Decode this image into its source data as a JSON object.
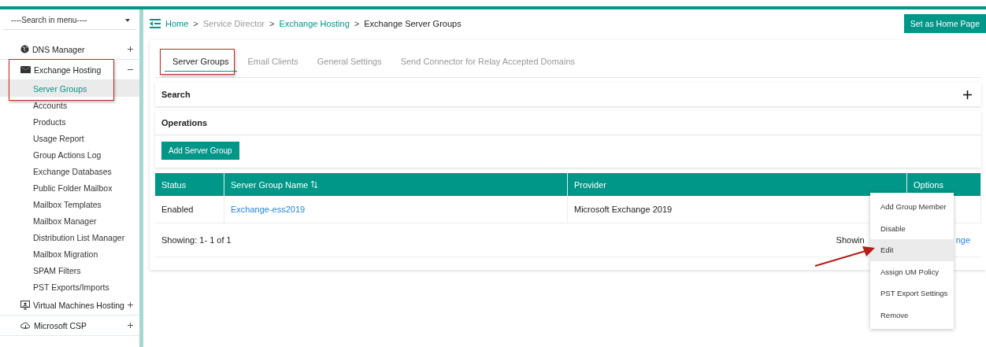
{
  "sidebar": {
    "search": {
      "placeholder": "----Search in menu----"
    },
    "items": [
      {
        "label": "DNS Manager",
        "expanded": false
      },
      {
        "label": "Exchange Hosting",
        "expanded": true,
        "children": [
          {
            "label": "Server Groups",
            "selected": true
          },
          {
            "label": "Accounts",
            "selected": false
          },
          {
            "label": "Products",
            "selected": false
          },
          {
            "label": "Usage Report",
            "selected": false
          },
          {
            "label": "Group Actions Log",
            "selected": false
          },
          {
            "label": "Exchange Databases",
            "selected": false
          },
          {
            "label": "Public Folder Mailbox",
            "selected": false
          },
          {
            "label": "Mailbox Templates",
            "selected": false
          },
          {
            "label": "Mailbox Manager",
            "selected": false
          },
          {
            "label": "Distribution List Manager",
            "selected": false
          },
          {
            "label": "Mailbox Migration",
            "selected": false
          },
          {
            "label": "SPAM Filters",
            "selected": false
          },
          {
            "label": "PST Exports/Imports",
            "selected": false
          }
        ]
      },
      {
        "label": "Virtual Machines Hosting",
        "expanded": false
      },
      {
        "label": "Microsoft CSP",
        "expanded": false
      }
    ]
  },
  "breadcrumb_separator": ">",
  "breadcrumb": [
    {
      "label": "Home",
      "kind": "link"
    },
    {
      "label": "Service Director",
      "kind": "muted"
    },
    {
      "label": "Exchange Hosting",
      "kind": "link"
    },
    {
      "label": "Exchange Server Groups",
      "kind": "current"
    }
  ],
  "home_button": "Set as Home Page",
  "tabs": [
    {
      "label": "Server Groups",
      "selected": true
    },
    {
      "label": "Email Clients",
      "selected": false
    },
    {
      "label": "General Settings",
      "selected": false
    },
    {
      "label": "Send Connector for Relay Accepted Domains",
      "selected": false
    }
  ],
  "search_panel": {
    "title": "Search",
    "expanded": false
  },
  "operations": {
    "title": "Operations",
    "buttons": [
      "Add Server Group"
    ]
  },
  "table": {
    "columns": [
      {
        "label": "Status",
        "sortable": false
      },
      {
        "label": "Server Group Name",
        "sortable": true
      },
      {
        "label": "Provider",
        "sortable": false
      },
      {
        "label": "Options",
        "sortable": false
      }
    ],
    "rows": [
      {
        "status": "Enabled",
        "name": "Exchange-ess2019",
        "provider": "Microsoft Exchange 2019"
      }
    ],
    "footer": {
      "showing": "Showing: 1- 1 of 1",
      "right_text": "Showin",
      "right_link": "nge"
    }
  },
  "options_menu": [
    {
      "label": "Add Group Member",
      "selected": false
    },
    {
      "label": "Disable",
      "selected": false
    },
    {
      "label": "Edit",
      "selected": true
    },
    {
      "label": "Assign UM Policy",
      "selected": false
    },
    {
      "label": "PST Export Settings",
      "selected": false
    },
    {
      "label": "Remove",
      "selected": false
    }
  ]
}
